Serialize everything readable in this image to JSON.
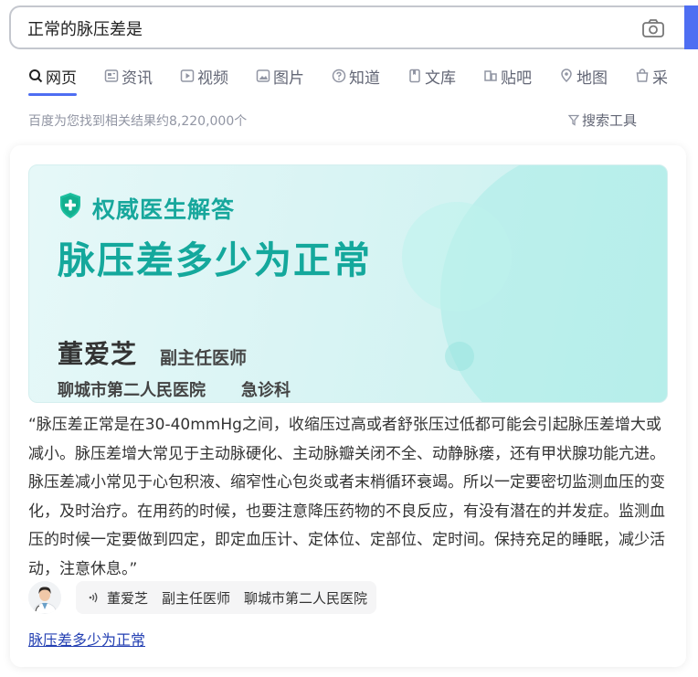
{
  "search": {
    "query": "正常的脉压差是"
  },
  "tabs": [
    {
      "label": "网页",
      "icon": "search-icon",
      "active": true
    },
    {
      "label": "资讯",
      "icon": "news-icon"
    },
    {
      "label": "视频",
      "icon": "video-icon"
    },
    {
      "label": "图片",
      "icon": "image-icon"
    },
    {
      "label": "知道",
      "icon": "question-icon"
    },
    {
      "label": "文库",
      "icon": "doc-icon"
    },
    {
      "label": "贴吧",
      "icon": "tieba-icon"
    },
    {
      "label": "地图",
      "icon": "map-icon"
    },
    {
      "label": "采",
      "icon": "shopping-icon"
    }
  ],
  "result_count": "百度为您找到相关结果约8,220,000个",
  "search_tools": "搜索工具",
  "card": {
    "badge": "权威医生解答",
    "title": "脉压差多少为正常",
    "doctor_name": "董爱芝",
    "doctor_title": "副主任医师",
    "hospital": "聊城市第二人民医院",
    "department": "急诊科",
    "answer": "“脉压差正常是在30-40mmHg之间，收缩压过高或者舒张压过低都可能会引起脉压差增大或减小。脉压差增大常见于主动脉硬化、主动脉瓣关闭不全、动静脉瘘，还有甲状腺功能亢进。脉压差减小常见于心包积液、缩窄性心包炎或者末梢循环衰竭。所以一定要密切监测血压的变化，及时治疗。在用药的时候，也要注意降压药物的不良反应，有没有潜在的并发症。监测血压的时候一定要做到四定，即定血压计、定体位、定部位、定时间。保持充足的睡眠，减少活动，注意休息。”",
    "pill": {
      "name": "董爱芝",
      "title": "副主任医师",
      "hospital": "聊城市第二人民医院"
    },
    "link": "脉压差多少为正常"
  },
  "colors": {
    "accent": "#4e6ef2",
    "teal": "#14a89c",
    "link": "#2440b3"
  }
}
